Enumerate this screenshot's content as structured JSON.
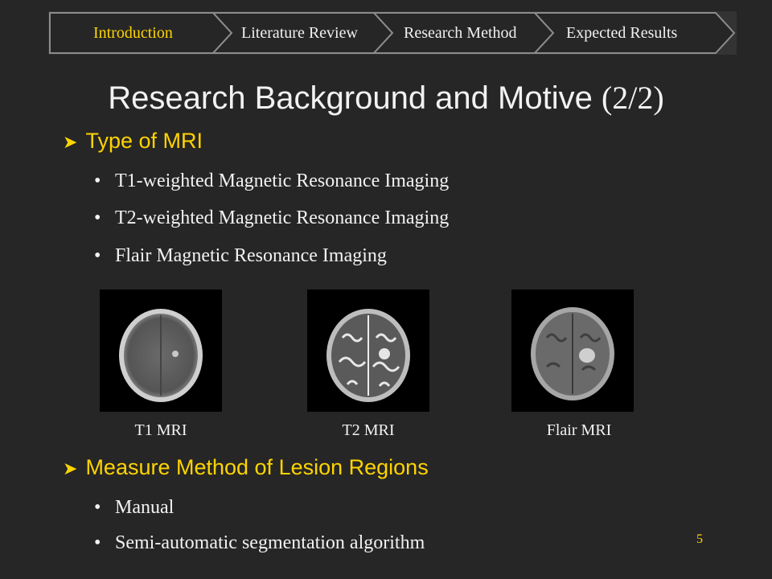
{
  "breadcrumb": {
    "items": [
      {
        "label": "Introduction",
        "active": true
      },
      {
        "label": "Literature Review",
        "active": false
      },
      {
        "label": "Research Method",
        "active": false
      },
      {
        "label": "Expected Results",
        "active": false
      }
    ]
  },
  "title": {
    "main": "Research Background and Motive ",
    "suffix": "(2/2)"
  },
  "section1": {
    "heading": "Type of MRI",
    "bullets": [
      "T1-weighted Magnetic Resonance Imaging",
      "T2-weighted Magnetic Resonance Imaging",
      "Flair Magnetic Resonance Imaging"
    ]
  },
  "images": {
    "captions": [
      "T1 MRI",
      "T2 MRI",
      "Flair MRI"
    ]
  },
  "section2": {
    "heading": "Measure Method of Lesion Regions",
    "bullets": [
      "Manual",
      "Semi-automatic segmentation algorithm"
    ]
  },
  "page_number": "5",
  "colors": {
    "background": "#262626",
    "accent": "#ffd400",
    "text": "#f2f2f2"
  }
}
